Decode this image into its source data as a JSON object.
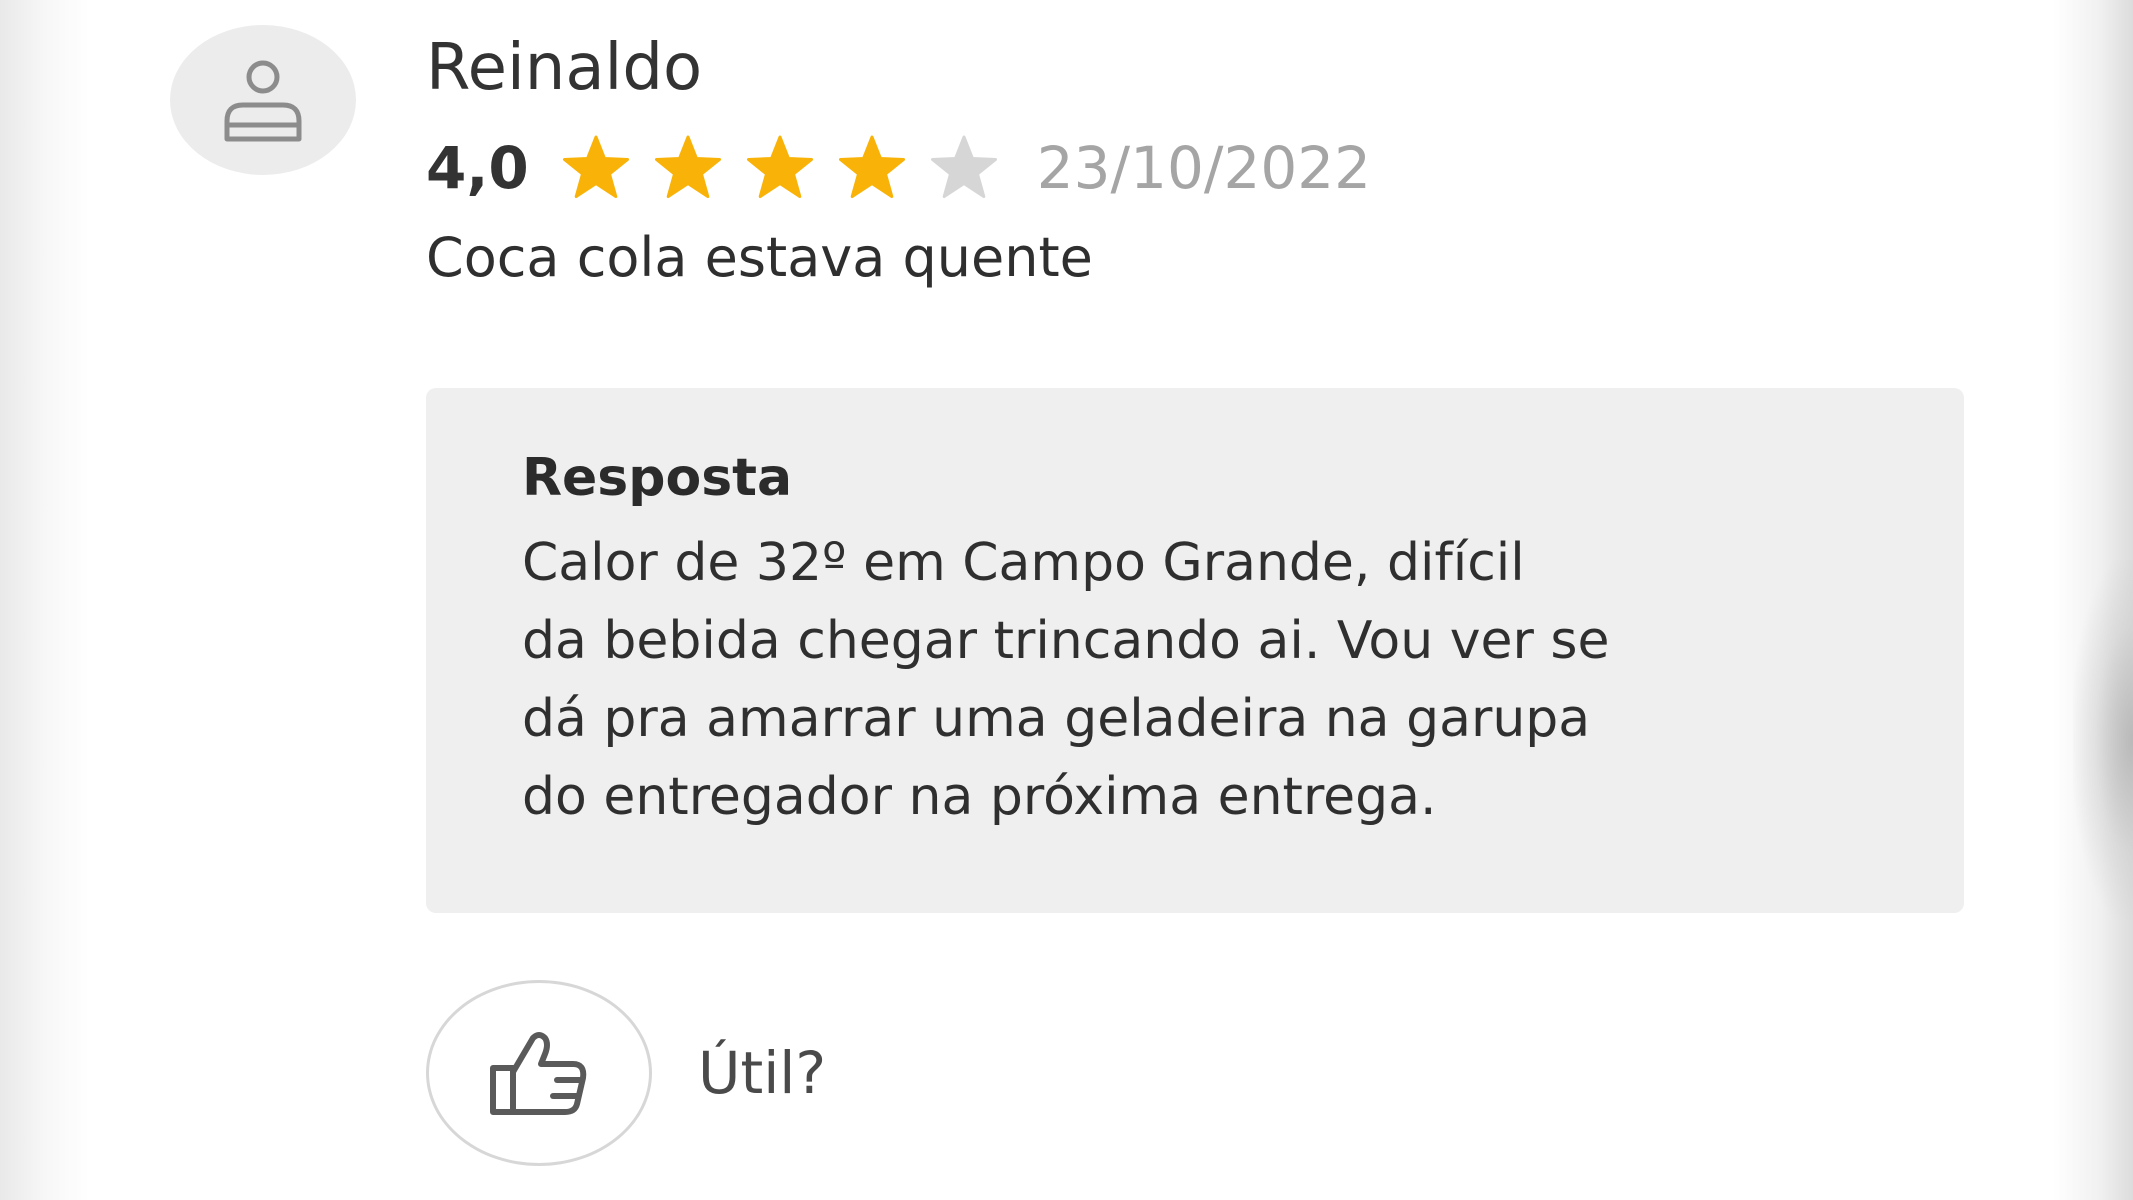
{
  "review": {
    "author": "Reinaldo",
    "rating_text": "4,0",
    "rating": 4,
    "rating_max": 5,
    "date": "23/10/2022",
    "comment": "Coca cola estava quente",
    "avatar_icon": "user-placeholder-icon"
  },
  "reply": {
    "title": "Resposta",
    "lines": [
      "Calor de 32º em Campo Grande, difícil",
      "da bebida chegar trincando ai. Vou ver se",
      "dá pra amarrar uma geladeira na garupa",
      "do entregador na próxima entrega."
    ]
  },
  "helpful": {
    "label": "Útil?",
    "icon": "thumbs-up-icon"
  },
  "colors": {
    "star_filled": "#F9B308",
    "star_empty": "#D6D6D6",
    "reply_background": "#EFEFEF",
    "date_text": "#A5A5A5"
  }
}
